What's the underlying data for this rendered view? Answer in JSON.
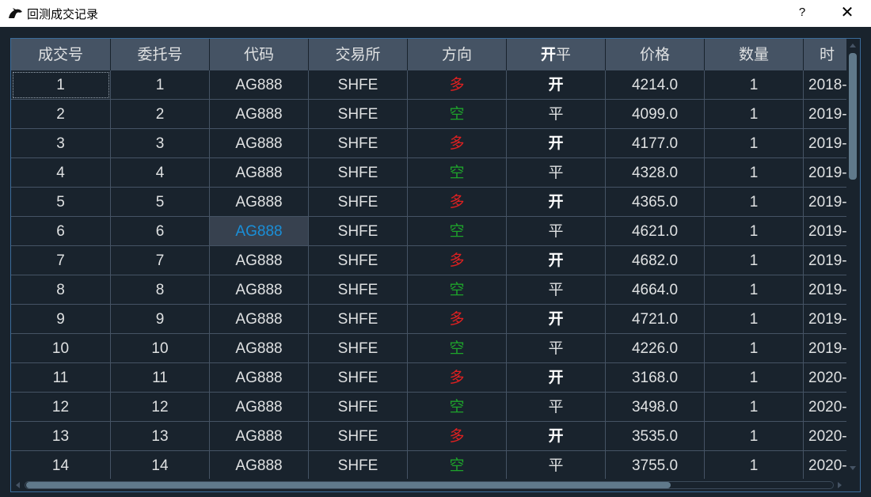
{
  "window": {
    "title": "回测成交记录",
    "help_label": "?",
    "close_label": "✕",
    "icon": "horse-head-icon"
  },
  "table": {
    "headers": [
      "成交号",
      "委托号",
      "代码",
      "交易所",
      "方向",
      "开",
      "平",
      "价格",
      "数量",
      "时"
    ],
    "rows": [
      {
        "tradeid": "1",
        "orderid": "1",
        "symbol": "AG888",
        "exchange": "SHFE",
        "direction": "多",
        "offset": "开",
        "price": "4214.0",
        "volume": "1",
        "time": "2018-"
      },
      {
        "tradeid": "2",
        "orderid": "2",
        "symbol": "AG888",
        "exchange": "SHFE",
        "direction": "空",
        "offset": "平",
        "price": "4099.0",
        "volume": "1",
        "time": "2019-"
      },
      {
        "tradeid": "3",
        "orderid": "3",
        "symbol": "AG888",
        "exchange": "SHFE",
        "direction": "多",
        "offset": "开",
        "price": "4177.0",
        "volume": "1",
        "time": "2019-"
      },
      {
        "tradeid": "4",
        "orderid": "4",
        "symbol": "AG888",
        "exchange": "SHFE",
        "direction": "空",
        "offset": "平",
        "price": "4328.0",
        "volume": "1",
        "time": "2019-"
      },
      {
        "tradeid": "5",
        "orderid": "5",
        "symbol": "AG888",
        "exchange": "SHFE",
        "direction": "多",
        "offset": "开",
        "price": "4365.0",
        "volume": "1",
        "time": "2019-"
      },
      {
        "tradeid": "6",
        "orderid": "6",
        "symbol": "AG888",
        "exchange": "SHFE",
        "direction": "空",
        "offset": "平",
        "price": "4621.0",
        "volume": "1",
        "time": "2019-"
      },
      {
        "tradeid": "7",
        "orderid": "7",
        "symbol": "AG888",
        "exchange": "SHFE",
        "direction": "多",
        "offset": "开",
        "price": "4682.0",
        "volume": "1",
        "time": "2019-"
      },
      {
        "tradeid": "8",
        "orderid": "8",
        "symbol": "AG888",
        "exchange": "SHFE",
        "direction": "空",
        "offset": "平",
        "price": "4664.0",
        "volume": "1",
        "time": "2019-"
      },
      {
        "tradeid": "9",
        "orderid": "9",
        "symbol": "AG888",
        "exchange": "SHFE",
        "direction": "多",
        "offset": "开",
        "price": "4721.0",
        "volume": "1",
        "time": "2019-"
      },
      {
        "tradeid": "10",
        "orderid": "10",
        "symbol": "AG888",
        "exchange": "SHFE",
        "direction": "空",
        "offset": "平",
        "price": "4226.0",
        "volume": "1",
        "time": "2019-"
      },
      {
        "tradeid": "11",
        "orderid": "11",
        "symbol": "AG888",
        "exchange": "SHFE",
        "direction": "多",
        "offset": "开",
        "price": "3168.0",
        "volume": "1",
        "time": "2020-"
      },
      {
        "tradeid": "12",
        "orderid": "12",
        "symbol": "AG888",
        "exchange": "SHFE",
        "direction": "空",
        "offset": "平",
        "price": "3498.0",
        "volume": "1",
        "time": "2020-"
      },
      {
        "tradeid": "13",
        "orderid": "13",
        "symbol": "AG888",
        "exchange": "SHFE",
        "direction": "多",
        "offset": "开",
        "price": "3535.0",
        "volume": "1",
        "time": "2020-"
      },
      {
        "tradeid": "14",
        "orderid": "14",
        "symbol": "AG888",
        "exchange": "SHFE",
        "direction": "空",
        "offset": "平",
        "price": "3755.0",
        "volume": "1",
        "time": "2020-"
      }
    ],
    "focused_row": 0,
    "selected_row": 5,
    "selected_column": "symbol"
  },
  "colors": {
    "background": "#19232d",
    "header_background": "#455364",
    "long": "#e02020",
    "short": "#1ea32b",
    "selected_text": "#1a8fd8",
    "border_accent": "#3b6c9a"
  },
  "scroll": {
    "vertical_position": 0.0,
    "horizontal_position": 0.0
  }
}
